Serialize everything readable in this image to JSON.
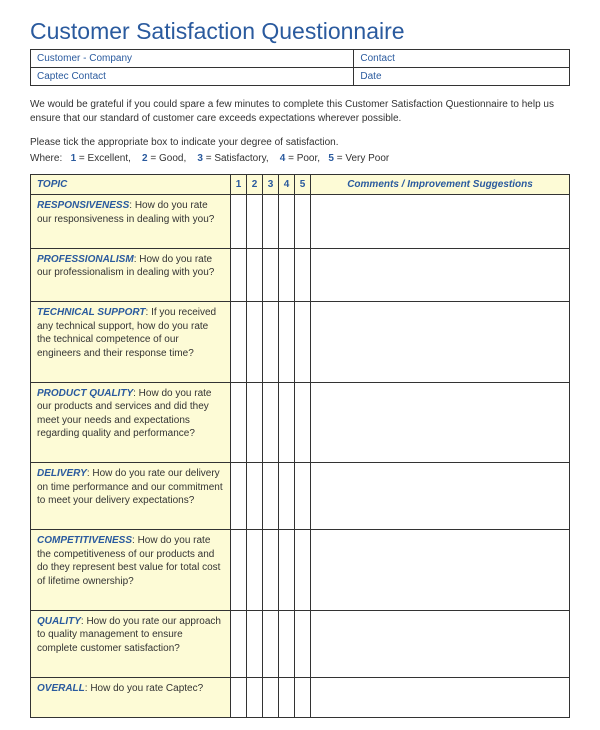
{
  "title": "Customer Satisfaction Questionnaire",
  "info": {
    "customer_company_label": "Customer - Company",
    "contact_label": "Contact",
    "captec_contact_label": "Captec Contact",
    "date_label": "Date"
  },
  "intro": "We would be grateful if you could spare a few minutes to complete this Customer Satisfaction Questionnaire to help us ensure that our standard of customer care exceeds expectations wherever possible.",
  "instructions": "Please tick the appropriate box to indicate your degree of satisfaction.",
  "scale": {
    "where": "Where:",
    "items": [
      {
        "num": "1",
        "label": "= Excellent,"
      },
      {
        "num": "2",
        "label": "= Good,"
      },
      {
        "num": "3",
        "label": "= Satisfactory,"
      },
      {
        "num": "4",
        "label": "= Poor,"
      },
      {
        "num": "5",
        "label": "= Very Poor"
      }
    ]
  },
  "headers": {
    "topic": "TOPIC",
    "r1": "1",
    "r2": "2",
    "r3": "3",
    "r4": "4",
    "r5": "5",
    "comments": "Comments / Improvement Suggestions"
  },
  "topics": [
    {
      "name": "RESPONSIVENESS",
      "desc": ": How do you rate our responsiveness in dealing with you?"
    },
    {
      "name": "PROFESSIONALISM",
      "desc": ": How do you rate our professionalism in dealing with you?"
    },
    {
      "name": "TECHNICAL SUPPORT",
      "desc": ": If you received any technical support, how do you rate the technical competence of our engineers and their response time?"
    },
    {
      "name": "PRODUCT QUALITY",
      "desc": ": How do you rate our products and services and did they meet your needs and expectations regarding quality and performance?"
    },
    {
      "name": "DELIVERY",
      "desc": ": How do you rate our delivery on time performance and our commitment to meet your delivery expectations?"
    },
    {
      "name": "COMPETITIVENESS",
      "desc": ": How do you rate the competitiveness of our products and do they represent best value for total cost of lifetime ownership?"
    },
    {
      "name": "QUALITY",
      "desc": ": How do you rate our approach to quality management to ensure complete customer satisfaction?"
    },
    {
      "name": "OVERALL",
      "desc": ": How do you rate Captec?"
    }
  ]
}
